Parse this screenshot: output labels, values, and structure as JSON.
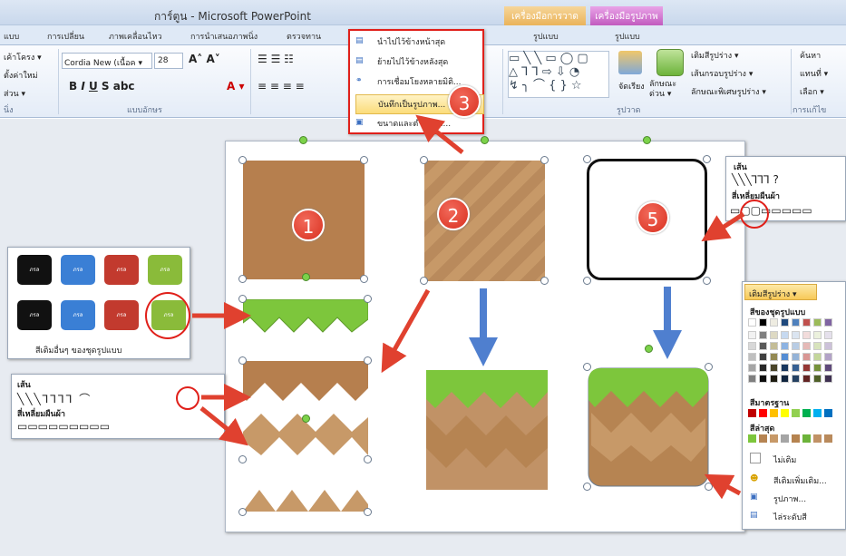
{
  "app": {
    "title": "การ์ตูน - Microsoft PowerPoint"
  },
  "context_tabs": {
    "drawing": "เครื่องมือการวาด",
    "picture": "เครื่องมือรูปภาพ"
  },
  "tabs": [
    "แบบ",
    "การเปลี่ยน",
    "ภาพเคลื่อนไหว",
    "การนำเสนอภาพนิ่ง",
    "ตรวจทาน",
    "รูปแบบ",
    "รูปแบบ"
  ],
  "ribbon": {
    "slides_group": [
      "เค้าโครง ▾",
      "ตั้งค่าใหม่",
      "ส่วน ▾",
      "นิ่ง"
    ],
    "font_name": "Cordia New (เนื้อค ▾",
    "font_size": "28",
    "font_group_label": "แบบอักษร",
    "drawing_label": "รูปวาด",
    "arrange_label": "จัดเรียง",
    "quick_styles_label": "ลักษณะ ด่วน ▾",
    "shape_fill": "เติมสีรูปร่าง ▾",
    "shape_outline": "เส้นกรอบรูปร่าง ▾",
    "shape_effects": "ลักษณะพิเศษรูปร่าง ▾",
    "find": "ค้นหา",
    "replace": "แทนที่ ▾",
    "select": "เลือก ▾",
    "editing_label": "การแก้ไข"
  },
  "context_menu": {
    "items": [
      "นำไปไว้ข้างหน้าสุด",
      "ย้ายไปไว้ข้างหลังสุด",
      "การเชื่อมโยงหลายมิติ...",
      "บันทึกเป็นรูปภาพ...",
      "ขนาดและตำแหน่ง..."
    ]
  },
  "badges": [
    "1",
    "2",
    "3",
    "5"
  ],
  "quick_styles_panel": {
    "footer": "สีเติมอื่นๆ ของชุดรูปแบบ",
    "button_text": "ภรล"
  },
  "lines_panel": {
    "title": "เส้น",
    "subtitle": "สี่เหลี่ยมผืนผ้า"
  },
  "right_shapes_panel": {
    "title": "เส้น",
    "subtitle": "สี่เหลี่ยมผืนผ้า"
  },
  "fill_menu": {
    "header": "เติมสีรูปร่าง ▾",
    "theme_colors": "สีของชุดรูปแบบ",
    "standard_colors": "สีมาตรฐาน",
    "recent_colors": "สีล่าสุด",
    "no_fill": "ไม่เติม",
    "more_colors": "สีเติมเพิ่มเติม...",
    "picture": "รูปภาพ...",
    "gradient": "ไล่ระดับสี"
  },
  "colors": {
    "accent_red": "#e0201a",
    "arrow_blue": "#4f7fcf",
    "grass": "#7dc63c",
    "dirt": "#b5834f"
  }
}
